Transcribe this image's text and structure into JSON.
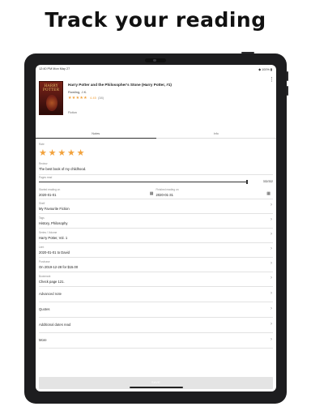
{
  "headline": "Track your reading",
  "status_bar": {
    "time": "12:40 PM  Mon May 27",
    "right": "◆ 100% ▮"
  },
  "book": {
    "cover_title": "HARRY\nPOTTER",
    "title": "Harry Potter and the Philosopher's Stone (Harry Potter, #1)",
    "author": "Rowling, J.K.",
    "stars": "★★★★★",
    "rating": "4.45",
    "rating_count": "(38)",
    "status": "Fiction"
  },
  "tabs": [
    "Notes",
    "Info"
  ],
  "rate": {
    "label": "Rate",
    "stars": "★★★★★"
  },
  "review": {
    "label": "Review",
    "value": "The best book of my childhood."
  },
  "progress": {
    "label": "Pages read",
    "pages": "332/332",
    "fraction": 1.0
  },
  "dates": {
    "started_label": "Started reading on",
    "started_value": "2020-01-01",
    "finished_label": "Finished reading on",
    "finished_value": "2020-01-31"
  },
  "fields": [
    {
      "label": "Shelf",
      "value": "My Favourite Fiction"
    },
    {
      "label": "Tags",
      "value": "History, Philosophy"
    },
    {
      "label": "Series / Volume",
      "value": "Harry Potter, Vol. 1"
    },
    {
      "label": "Lent",
      "value": "2020-01-01 to David"
    },
    {
      "label": "Purchase",
      "value": "On 2019-12-28 for $15.00"
    },
    {
      "label": "Bookmark",
      "value": "Check page 121."
    }
  ],
  "links": [
    "Advanced note",
    "Quotes",
    "Additional dates read",
    "More"
  ],
  "save_label": "SAVE",
  "icons": {
    "overflow": "more-vert-icon",
    "calendar": "calendar-icon",
    "chevron": "chevron-right-icon",
    "star": "star-icon"
  },
  "colors": {
    "star": "#f2a23c",
    "save_bar": "#e4e4e4"
  }
}
